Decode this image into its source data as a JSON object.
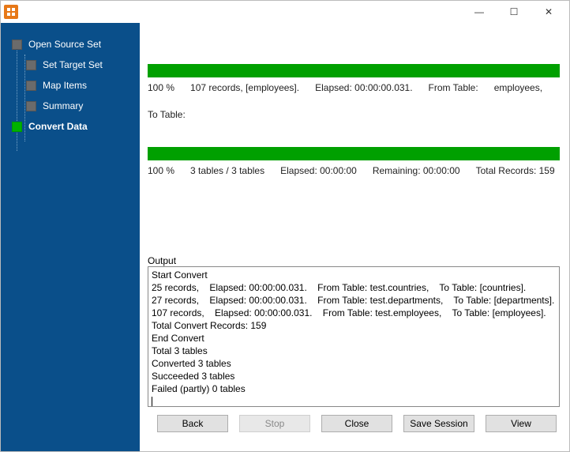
{
  "window": {
    "minimize_glyph": "—",
    "maximize_glyph": "☐",
    "close_glyph": "✕"
  },
  "sidebar": {
    "items": [
      {
        "label": "Open Source Set"
      },
      {
        "label": "Set Target Set"
      },
      {
        "label": "Map Items"
      },
      {
        "label": "Summary"
      },
      {
        "label": "Convert Data"
      }
    ]
  },
  "progress1": {
    "percent": "100 %",
    "records": "107 records, [employees].",
    "elapsed": "Elapsed: 00:00:00.031.",
    "from": "From Table:",
    "from_val": "employees,",
    "to": "To Table:"
  },
  "progress2": {
    "percent": "100 %",
    "tables": "3 tables / 3 tables",
    "elapsed": "Elapsed: 00:00:00",
    "remaining": "Remaining: 00:00:00",
    "total": "Total Records: 159"
  },
  "output_label": "Output",
  "output_text": "Start Convert\n25 records,    Elapsed: 00:00:00.031.    From Table: test.countries,    To Table: [countries].\n27 records,    Elapsed: 00:00:00.031.    From Table: test.departments,    To Table: [departments].\n107 records,    Elapsed: 00:00:00.031.    From Table: test.employees,    To Table: [employees].\nTotal Convert Records: 159\nEnd Convert\nTotal 3 tables\nConverted 3 tables\nSucceeded 3 tables\nFailed (partly) 0 tables\n",
  "buttons": {
    "back": "Back",
    "stop": "Stop",
    "close": "Close",
    "save": "Save Session",
    "view": "View"
  }
}
